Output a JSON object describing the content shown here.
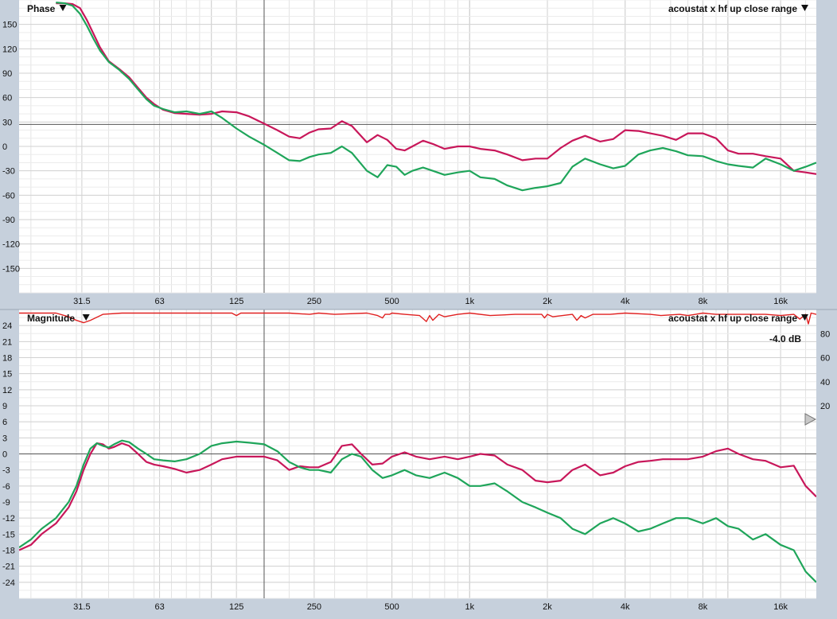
{
  "chart_data": [
    {
      "type": "line",
      "title": "Phase",
      "measurement_label": "acoustat x hf up close range",
      "x_scale": "log",
      "xlim": [
        18,
        22000
      ],
      "ylim": [
        -180,
        180
      ],
      "x_ticks": [
        {
          "value": 31.5,
          "label": "31.5"
        },
        {
          "value": 63,
          "label": "63"
        },
        {
          "value": 125,
          "label": "125"
        },
        {
          "value": 250,
          "label": "250"
        },
        {
          "value": 500,
          "label": "500"
        },
        {
          "value": 1000,
          "label": "1k"
        },
        {
          "value": 2000,
          "label": "2k"
        },
        {
          "value": 4000,
          "label": "4k"
        },
        {
          "value": 8000,
          "label": "8k"
        },
        {
          "value": 16000,
          "label": "16k"
        }
      ],
      "y_ticks": [
        150,
        120,
        90,
        60,
        30,
        0,
        -30,
        -60,
        -90,
        -120,
        -150
      ],
      "y_tick_labels": [
        "150",
        "120",
        "90",
        "60",
        "30",
        "0",
        "-30",
        "-60",
        "-90",
        "-120",
        "-150"
      ],
      "cursor": {
        "x": 160,
        "y": 27
      },
      "series": [
        {
          "color": "#c8175a",
          "x": [
            25,
            27,
            29,
            31,
            33,
            35,
            37,
            40,
            44,
            48,
            52,
            56,
            60,
            65,
            72,
            80,
            90,
            100,
            110,
            125,
            140,
            160,
            180,
            200,
            220,
            240,
            260,
            290,
            320,
            350,
            400,
            440,
            480,
            520,
            560,
            600,
            660,
            720,
            800,
            900,
            1000,
            1100,
            1250,
            1400,
            1600,
            1800,
            2000,
            2250,
            2500,
            2800,
            3200,
            3600,
            4000,
            4500,
            5000,
            5600,
            6300,
            7000,
            8000,
            9000,
            10000,
            11000,
            12500,
            14000,
            16000,
            18000,
            20000,
            22000
          ],
          "y": [
            176,
            176,
            175,
            170,
            155,
            138,
            122,
            105,
            95,
            85,
            72,
            60,
            52,
            45,
            41,
            40,
            39,
            40,
            43,
            42,
            37,
            28,
            20,
            12,
            10,
            17,
            21,
            22,
            31,
            25,
            5,
            14,
            8,
            -3,
            -5,
            0,
            7,
            3,
            -3,
            0,
            0,
            -3,
            -5,
            -10,
            -17,
            -15,
            -15,
            -2,
            7,
            13,
            6,
            9,
            20,
            19,
            16,
            13,
            8,
            16,
            16,
            10,
            -5,
            -9,
            -9,
            -12,
            -15,
            -30,
            -32,
            -34
          ]
        },
        {
          "color": "#1fa55a",
          "x": [
            25,
            27,
            29,
            31,
            33,
            35,
            37,
            40,
            44,
            48,
            52,
            56,
            60,
            65,
            72,
            80,
            90,
            100,
            110,
            125,
            140,
            160,
            180,
            200,
            220,
            240,
            260,
            290,
            320,
            350,
            400,
            440,
            480,
            520,
            560,
            600,
            660,
            720,
            800,
            900,
            1000,
            1100,
            1250,
            1400,
            1600,
            1800,
            2000,
            2250,
            2500,
            2800,
            3200,
            3600,
            4000,
            4500,
            5000,
            5600,
            6300,
            7000,
            8000,
            9000,
            10000,
            11000,
            12500,
            14000,
            16000,
            18000,
            20000,
            22000
          ],
          "y": [
            177,
            176,
            173,
            163,
            148,
            132,
            118,
            104,
            94,
            83,
            70,
            58,
            50,
            46,
            42,
            43,
            40,
            43,
            35,
            22,
            12,
            2,
            -8,
            -17,
            -18,
            -13,
            -10,
            -8,
            0,
            -8,
            -30,
            -38,
            -23,
            -25,
            -35,
            -30,
            -26,
            -30,
            -35,
            -32,
            -30,
            -38,
            -40,
            -48,
            -54,
            -51,
            -49,
            -45,
            -25,
            -15,
            -22,
            -27,
            -24,
            -10,
            -5,
            -2,
            -6,
            -11,
            -12,
            -18,
            -22,
            -24,
            -26,
            -15,
            -22,
            -30,
            -25,
            -20
          ]
        }
      ]
    },
    {
      "type": "line",
      "title": "Magnitude",
      "measurement_label": "acoustat x hf up close range",
      "readout": "-4.0 dB",
      "x_scale": "log",
      "xlim": [
        18,
        22000
      ],
      "ylim": [
        -27,
        27
      ],
      "x_ticks": [
        {
          "value": 31.5,
          "label": "31.5"
        },
        {
          "value": 63,
          "label": "63"
        },
        {
          "value": 125,
          "label": "125"
        },
        {
          "value": 250,
          "label": "250"
        },
        {
          "value": 500,
          "label": "500"
        },
        {
          "value": 1000,
          "label": "1k"
        },
        {
          "value": 2000,
          "label": "2k"
        },
        {
          "value": 4000,
          "label": "4k"
        },
        {
          "value": 8000,
          "label": "8k"
        },
        {
          "value": 16000,
          "label": "16k"
        }
      ],
      "y_ticks": [
        24,
        21,
        18,
        15,
        12,
        9,
        6,
        3,
        0,
        -3,
        -6,
        -9,
        -12,
        -15,
        -18,
        -21,
        -24
      ],
      "y_tick_labels": [
        "24",
        "21",
        "18",
        "15",
        "12",
        "9",
        "6",
        "3",
        "0",
        "-3",
        "-6",
        "-9",
        "-12",
        "-15",
        "-18",
        "-21",
        "-24"
      ],
      "right_ylim": [
        -140,
        100
      ],
      "right_ticks": [
        80,
        60,
        40,
        20
      ],
      "right_tick_labels": [
        "80",
        "60",
        "40",
        "20"
      ],
      "cursor": {
        "x": 160,
        "y": 0
      },
      "series": [
        {
          "color": "#c8175a",
          "x": [
            18,
            20,
            22,
            25,
            28,
            30,
            32,
            34,
            36,
            38,
            40,
            42,
            45,
            48,
            52,
            56,
            60,
            65,
            72,
            80,
            90,
            100,
            110,
            125,
            140,
            160,
            180,
            200,
            220,
            240,
            260,
            290,
            320,
            350,
            380,
            420,
            460,
            500,
            560,
            620,
            700,
            800,
            900,
            1000,
            1100,
            1250,
            1400,
            1600,
            1800,
            2000,
            2250,
            2500,
            2800,
            3200,
            3600,
            4000,
            4500,
            5000,
            5600,
            6300,
            7000,
            8000,
            9000,
            10000,
            11000,
            12500,
            14000,
            16000,
            18000,
            20000,
            22000
          ],
          "y": [
            -18,
            -17,
            -15,
            -13,
            -10,
            -7,
            -3,
            0,
            2,
            1.8,
            1,
            1.3,
            2,
            1.5,
            0,
            -1.5,
            -2,
            -2.3,
            -2.8,
            -3.5,
            -3,
            -2,
            -1,
            -0.5,
            -0.5,
            -0.5,
            -1.2,
            -3,
            -2.3,
            -2.5,
            -2.5,
            -1.5,
            1.5,
            1.8,
            0,
            -2,
            -1.8,
            -0.5,
            0.3,
            -0.5,
            -1,
            -0.5,
            -1,
            -0.5,
            0,
            -0.3,
            -2,
            -3,
            -5,
            -5.3,
            -5,
            -3,
            -2,
            -4,
            -3.5,
            -2.3,
            -1.5,
            -1.3,
            -1,
            -1,
            -1,
            -0.5,
            0.5,
            1,
            0,
            -1,
            -1.3,
            -2.5,
            -2.2,
            -6,
            -8
          ]
        },
        {
          "color": "#1fa55a",
          "x": [
            18,
            20,
            22,
            25,
            28,
            30,
            32,
            34,
            36,
            38,
            40,
            42,
            45,
            48,
            52,
            56,
            60,
            65,
            72,
            80,
            90,
            100,
            110,
            125,
            140,
            160,
            180,
            200,
            220,
            240,
            260,
            290,
            320,
            350,
            380,
            420,
            460,
            500,
            560,
            620,
            700,
            800,
            900,
            1000,
            1100,
            1250,
            1400,
            1600,
            1800,
            2000,
            2250,
            2500,
            2800,
            3200,
            3600,
            4000,
            4500,
            5000,
            5600,
            6300,
            7000,
            8000,
            9000,
            10000,
            11000,
            12500,
            14000,
            16000,
            18000,
            20000,
            22000
          ],
          "y": [
            -17.5,
            -16,
            -14,
            -12,
            -9,
            -6,
            -2,
            1,
            2,
            1.5,
            1.2,
            1.8,
            2.5,
            2.2,
            1,
            0,
            -1,
            -1.2,
            -1.4,
            -1,
            0,
            1.5,
            2,
            2.3,
            2.1,
            1.8,
            0.5,
            -1.5,
            -2.5,
            -3,
            -3,
            -3.5,
            -1,
            0,
            -0.5,
            -3,
            -4.5,
            -4,
            -3,
            -4,
            -4.5,
            -3.5,
            -4.5,
            -6,
            -6,
            -5.5,
            -7,
            -9,
            -10,
            -11,
            -12,
            -14,
            -15,
            -13,
            -12,
            -13,
            -14.5,
            -14,
            -13,
            -12,
            -12,
            -13,
            -12,
            -13.5,
            -14,
            -16,
            -15,
            -17,
            -18,
            -22,
            -24
          ]
        },
        {
          "color": "#e02020",
          "axis": "right",
          "x": [
            18,
            25,
            28,
            30,
            32,
            34,
            38,
            45,
            60,
            100,
            120,
            125,
            130,
            200,
            240,
            260,
            300,
            400,
            440,
            460,
            470,
            490,
            500,
            560,
            640,
            680,
            700,
            720,
            760,
            800,
            900,
            1000,
            1200,
            1500,
            1900,
            1950,
            2000,
            2100,
            2500,
            2600,
            2700,
            2800,
            3000,
            3500,
            4000,
            5000,
            5500,
            6500,
            7000,
            7500,
            8000,
            9000,
            11000,
            14000,
            16000,
            18000,
            19000,
            20000,
            20500,
            21000,
            22000
          ],
          "y": [
            97,
            97,
            94,
            91,
            89,
            91,
            96,
            97,
            97,
            97,
            97,
            95,
            97,
            97,
            96,
            97,
            96,
            97,
            95,
            93,
            96,
            96,
            97,
            96,
            95,
            90,
            95,
            91,
            96,
            94,
            96,
            97,
            95,
            96,
            96,
            93,
            96,
            94,
            96,
            91,
            95,
            93,
            96,
            96,
            97,
            96,
            95,
            96,
            95,
            96,
            97,
            96,
            96,
            96,
            95,
            96,
            92,
            96,
            88,
            97,
            96
          ]
        }
      ]
    }
  ]
}
